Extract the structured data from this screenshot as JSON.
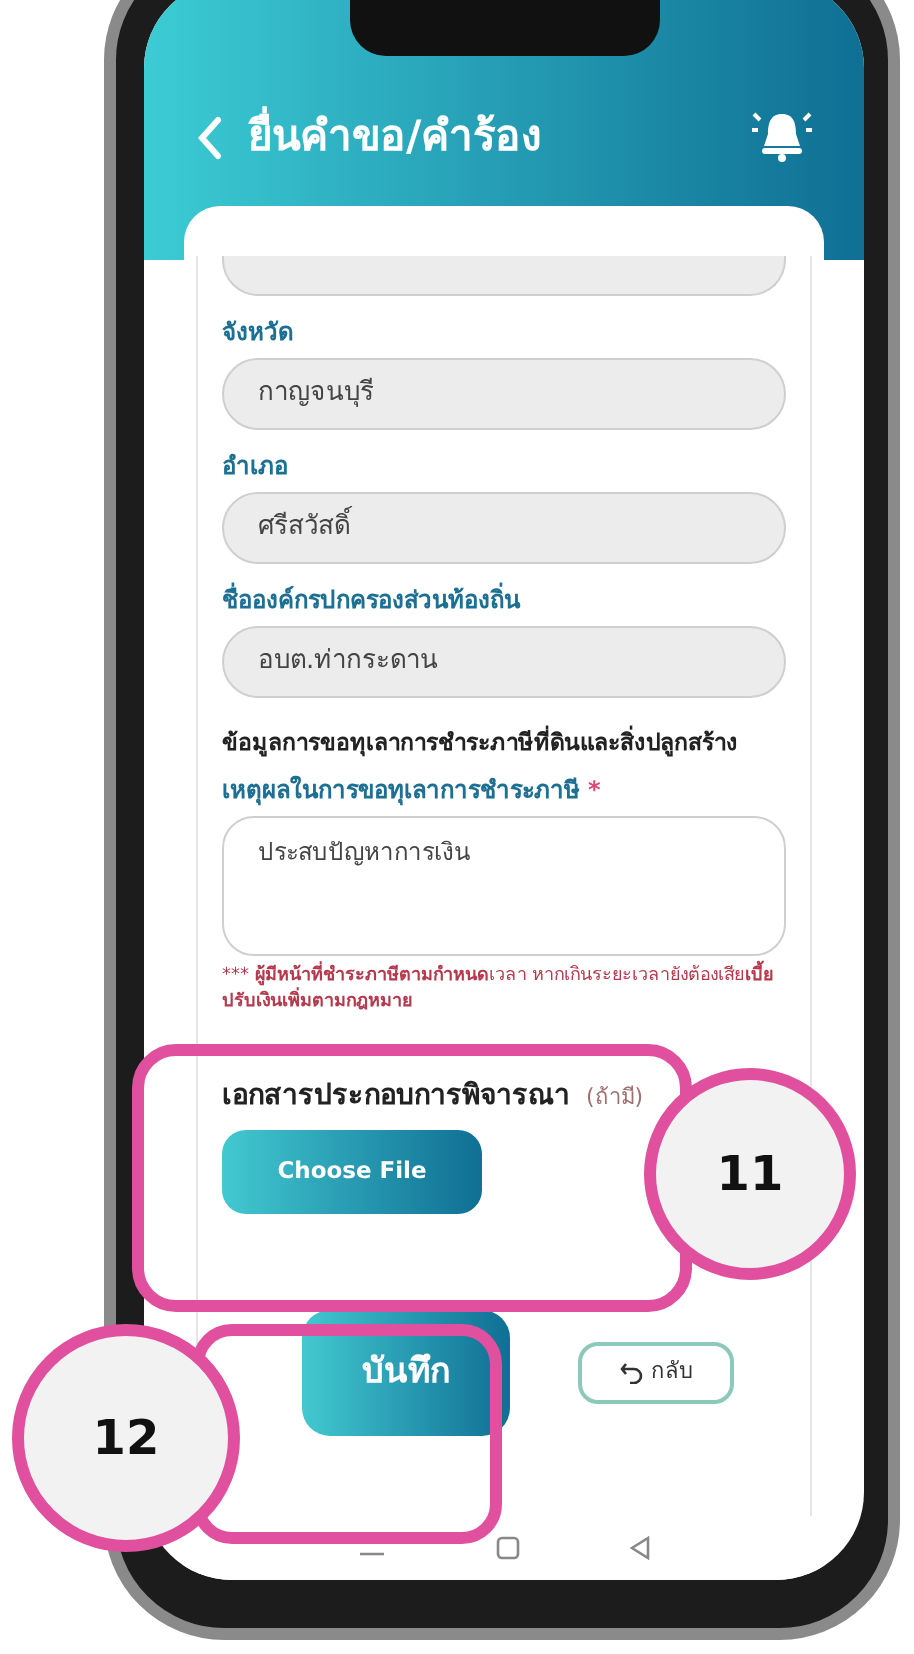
{
  "header": {
    "title": "ยื่นคำขอ/คำร้อง"
  },
  "fields": [
    {
      "label": "จังหวัด",
      "value": "กาญจนบุรี"
    },
    {
      "label": "อำเภอ",
      "value": "ศรีสวัสดิ์"
    },
    {
      "label": "ชื่อองค์กรปกครองส่วนท้องถิ่น",
      "value": "อบต.ท่ากระดาน"
    }
  ],
  "section_title": "ข้อมูลการขอทุเลาการชำระภาษีที่ดินและสิ่งปลูกสร้าง",
  "reason": {
    "label": "เหตุผลในการขอทุเลาการชำระภาษี",
    "required_mark": "*",
    "value": "ประสบปัญหาการเงิน"
  },
  "warning": {
    "mark": "***",
    "text": "**ผู้มีหน้าที่ชำระภาษีตามกำหนด**เวลา หากเกินระยะเวลายังต้องเสีย**เบี้ยปรับเงินเพิ่มตามกฎหมาย**"
  },
  "documents": {
    "label": "เอกสารประกอบการพิจารณา",
    "optional": "(ถ้ามี)",
    "button": "Choose File"
  },
  "actions": {
    "save": "บันทึก",
    "back": "กลับ"
  },
  "annotations": [
    {
      "number": "11"
    },
    {
      "number": "12"
    }
  ]
}
